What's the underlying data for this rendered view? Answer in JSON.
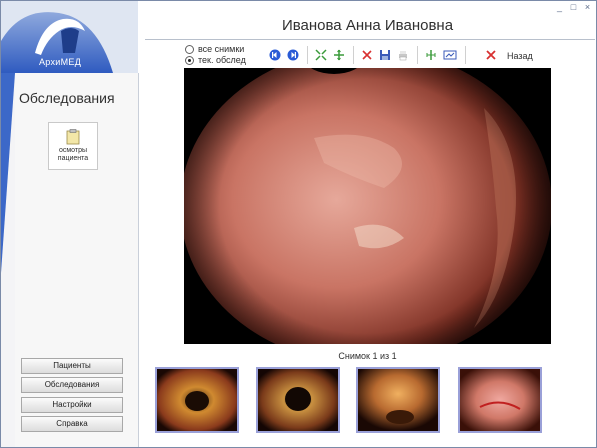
{
  "window": {
    "controls": [
      "_",
      "□",
      "×"
    ]
  },
  "app": {
    "logo_text": "АрхиМЕД"
  },
  "sidebar": {
    "title": "Обследования",
    "patient_item": {
      "label_line1": "осмотры",
      "label_line2": "пациента",
      "icon": "clipboard-icon"
    },
    "nav": [
      {
        "label": "Пациенты"
      },
      {
        "label": "Обследования"
      },
      {
        "label": "Настройки"
      },
      {
        "label": "Справка"
      }
    ]
  },
  "header": {
    "patient_name": "Иванова Анна Ивановна"
  },
  "toolbar": {
    "radio_all": "все снимки",
    "radio_current": "тек. обслед",
    "selected": "тек. обслед",
    "back_label": "Назад",
    "icons": [
      "prev-icon",
      "next-icon",
      "fit-icon",
      "zoom-icon",
      "delete-icon",
      "save-icon",
      "print-icon",
      "crop-icon",
      "compare-icon",
      "close-icon"
    ]
  },
  "viewer": {
    "counter": "Снимок 1 из 1"
  },
  "thumbnails": [
    {
      "name": "thumb-1"
    },
    {
      "name": "thumb-2"
    },
    {
      "name": "thumb-3"
    },
    {
      "name": "thumb-4"
    }
  ],
  "colors": {
    "accent_blue": "#2a5bd6",
    "logo_blue": "#3c68c8",
    "thumb_border": "#9aa0d8",
    "delete_red": "#d83030"
  }
}
